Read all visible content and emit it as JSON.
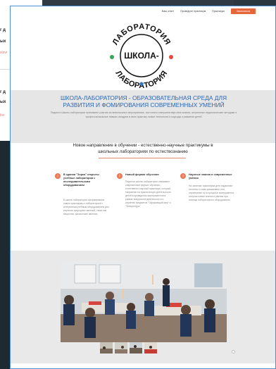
{
  "background_window": {
    "lines": [
      "г д",
      "ых",
      "г д",
      "ых"
    ],
    "links": [
      "slovr",
      "lov"
    ]
  },
  "nav": {
    "items": [
      "Ваш ответ",
      "Проведите практикум",
      "Практикум"
    ],
    "cta": "Записаться"
  },
  "logo": {
    "arc_top": "ЛАБОРАТОРИЯ",
    "center": "ШКОЛА-",
    "arc_bottom": "ЛАБОРАТОРИЯ"
  },
  "hero": {
    "title_line1": "ШКОЛА-ЛАБОРАТОРИЯ - ОБРАЗОВАТЕЛЬНАЯ СРЕДА ДЛЯ",
    "title_line2": "РАЗВИТИЯ И ФОМИРОВАНИЯ СОВРЕМЕННЫХ УМЕНИЙ",
    "text": "Педагоги Школы-лаборатории принимают участие во внеклассных мероприятиях, постоянно совершенствуя свои знания, актуальные педагогические методики и профессиональные навыки, внедряя в свою практику новые технологии и подходы к развитию детей"
  },
  "section": {
    "title_line1": "Новое направление в обучении - естественно-научные практикумы в",
    "title_line2": "школьных лабораториях по естествознанию"
  },
  "cards": [
    {
      "number": "1",
      "title": "В здании \"Зорко\" открыты учебные лаборатории с исследовательским оборудованием",
      "body": "В школе-лаборатории сформированы новые практикумы с лабораторией с интересным учебным оборудованием для изучения природных явлений, таких как вещества, физические явления"
    },
    {
      "number": "2",
      "title": "Новый формат обучения",
      "body": "Педагоги школы-лаборатории осваивают современный формат обучения - естественно-научный практикум, который направлен на практическую деятельность детей в проведении экспериментов в рамках внеурочной деятельности и изучения предметов \"Окружающий мир\" и \"Физкультура\""
    },
    {
      "number": "3",
      "title": "Научные знания и современные умения",
      "body": "На занятиях практикума дети выдвигают гипотезы и сами доказывают или опровергают их в процессе эксперимента, получая новые знания и умения при помощи лабораторного оборудования"
    }
  ],
  "gallery": {
    "thumb_count": 4
  },
  "colors": {
    "accent": "#e7653a",
    "title_blue": "#2a66b8",
    "window_border": "#4a8fd8"
  }
}
